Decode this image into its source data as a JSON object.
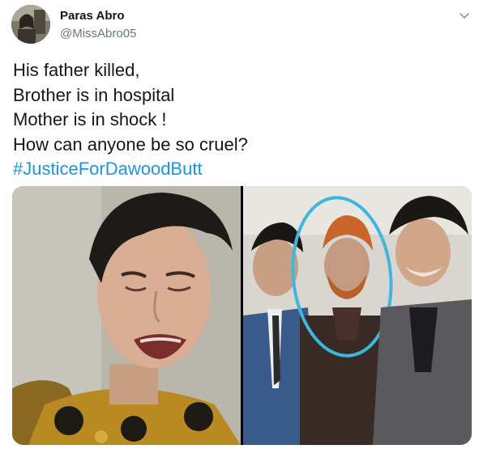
{
  "tweet": {
    "author": {
      "display_name": "Paras Abro",
      "handle": "@MissAbro05"
    },
    "text_lines": [
      "His father killed,",
      "Brother is in hospital",
      "Mother is in shock !",
      "How can anyone be so cruel?"
    ],
    "hashtag": "#JusticeForDawoodButt"
  },
  "colors": {
    "link": "#1b95e0",
    "muted": "#657786",
    "text": "#14171a"
  },
  "icons": {
    "more": "chevron-down-icon"
  }
}
